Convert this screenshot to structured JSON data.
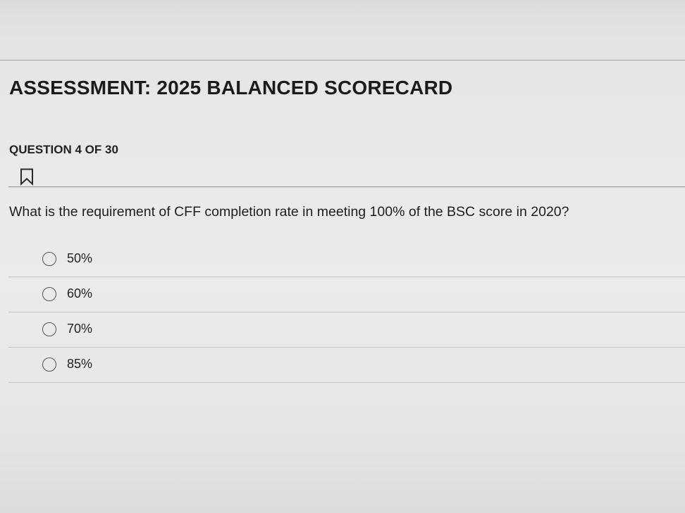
{
  "assessment": {
    "title": "ASSESSMENT: 2025 BALANCED SCORECARD"
  },
  "question": {
    "counter": "QUESTION 4 OF 30",
    "bookmark_icon": "bookmark-icon",
    "text": "What is the requirement of CFF completion rate in meeting 100% of the BSC score in 2020?",
    "options": [
      {
        "label": "50%",
        "selected": false
      },
      {
        "label": "60%",
        "selected": false
      },
      {
        "label": "70%",
        "selected": false
      },
      {
        "label": "85%",
        "selected": false
      }
    ]
  },
  "colors": {
    "text": "#1e1e1e",
    "rule": "#8f8f8e",
    "radio_border": "#555555",
    "background": "#e8e8e7"
  }
}
